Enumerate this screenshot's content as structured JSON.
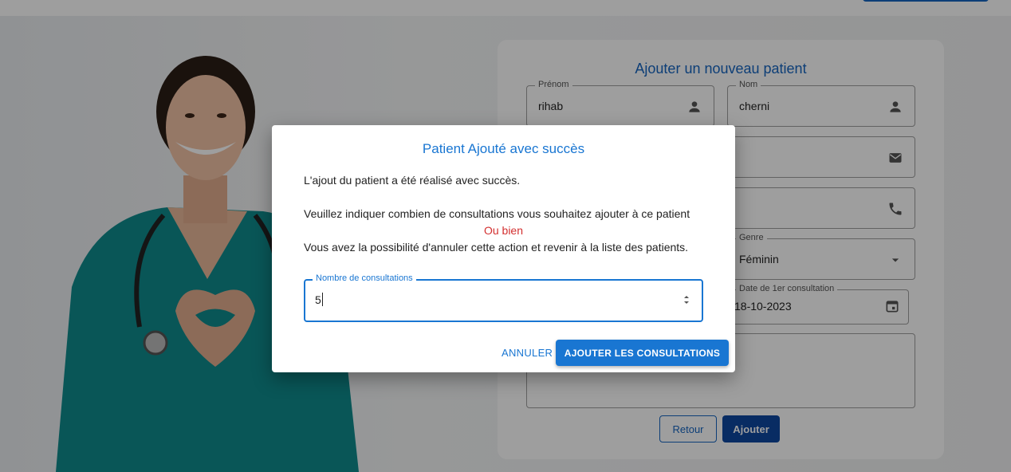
{
  "form": {
    "title": "Ajouter un nouveau patient",
    "prenom": {
      "label": "Prénom",
      "value": "rihab",
      "icon": "person-icon"
    },
    "nom": {
      "label": "Nom",
      "value": "cherni",
      "icon": "person-icon"
    },
    "email": {
      "icon": "email-icon"
    },
    "phone": {
      "icon": "phone-icon"
    },
    "genre": {
      "label": "Genre",
      "value": "Féminin",
      "icon": "dropdown-arrow-icon"
    },
    "date": {
      "label": "Date de 1er consultation",
      "value": "18-10-2023",
      "icon": "calendar-icon"
    },
    "retour_label": "Retour",
    "ajouter_label": "Ajouter"
  },
  "dialog": {
    "title": "Patient Ajouté avec succès",
    "line1": "L'ajout du patient a été réalisé avec succès.",
    "line2": "Veuillez indiquer combien de consultations vous souhaitez ajouter à ce patient",
    "or": "Ou bien",
    "line3": "Vous avez la possibilité d'annuler cette action et revenir à la liste des patients.",
    "field_label": "Nombre de consultations",
    "field_value": "5",
    "cancel_label": "ANNULER",
    "confirm_label": "AJOUTER LES CONSULTATIONS"
  },
  "colors": {
    "primary": "#1976d2",
    "dark_primary": "#0d47a1",
    "alert": "#d32f2f",
    "scrub": "#0f8b8d"
  }
}
